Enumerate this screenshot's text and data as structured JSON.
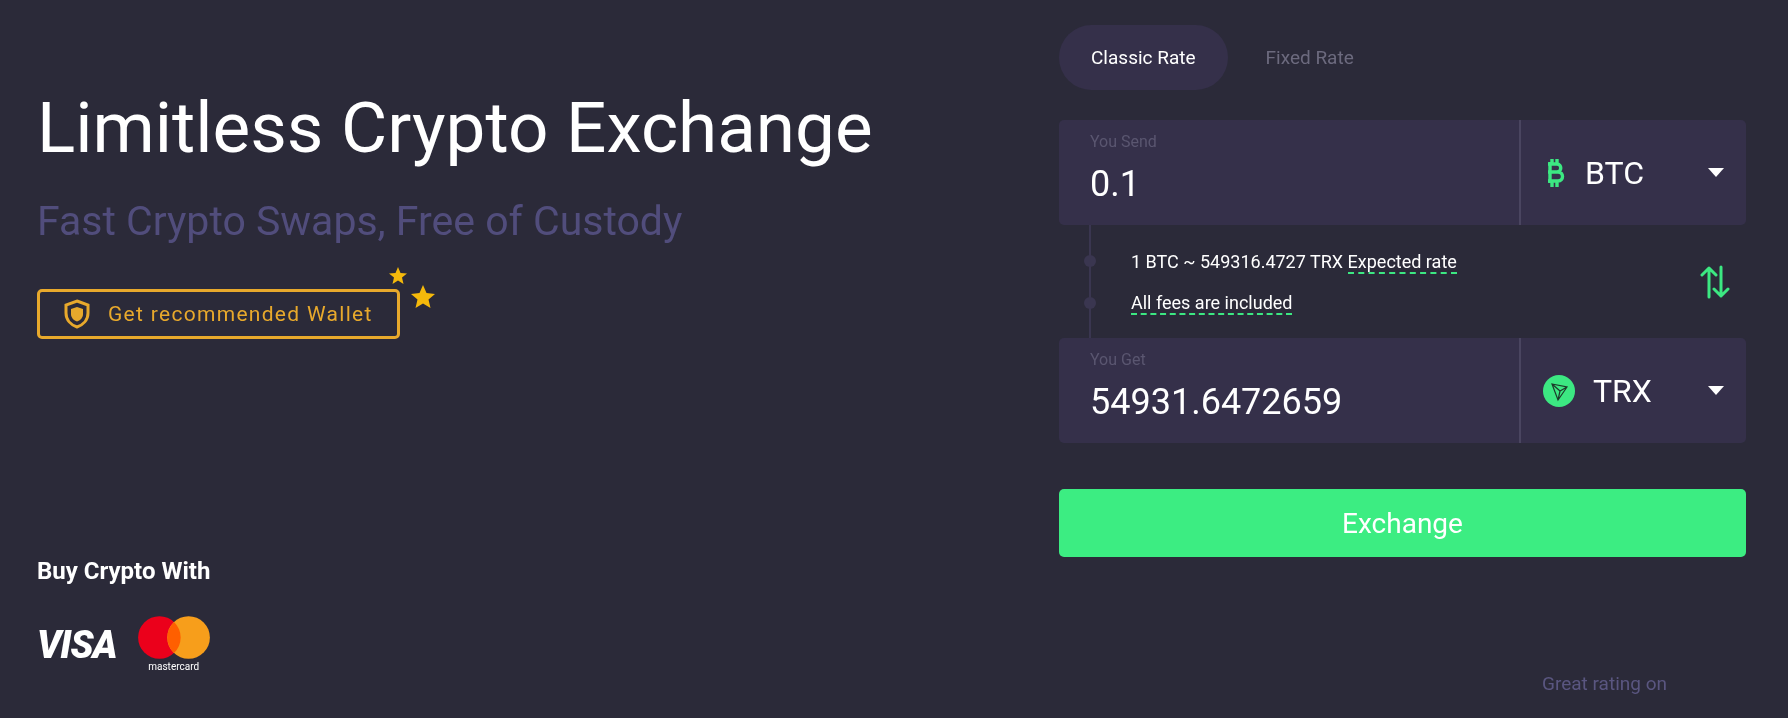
{
  "hero": {
    "title": "Limitless Crypto Exchange",
    "subtitle": "Fast Crypto Swaps, Free of Custody",
    "wallet_button": "Get recommended Wallet"
  },
  "payment": {
    "heading": "Buy Crypto With",
    "methods": [
      {
        "kind": "visa",
        "label": "VISA"
      },
      {
        "kind": "mastercard",
        "label": "mastercard"
      }
    ]
  },
  "tabs": [
    {
      "label": "Classic Rate",
      "selected": true
    },
    {
      "label": "Fixed Rate",
      "selected": false
    }
  ],
  "send": {
    "label": "You Send",
    "value": "0.1",
    "currency": {
      "kind": "btc",
      "code": "BTC"
    }
  },
  "rate": {
    "text": "1 BTC ~ 549316.4727 TRX",
    "link": "Expected rate",
    "fees": "All fees are included"
  },
  "get": {
    "label": "You Get",
    "value": "54931.6472659",
    "currency": {
      "kind": "trx",
      "code": "TRX"
    }
  },
  "exchange_button": "Exchange",
  "rating": "Great rating on"
}
